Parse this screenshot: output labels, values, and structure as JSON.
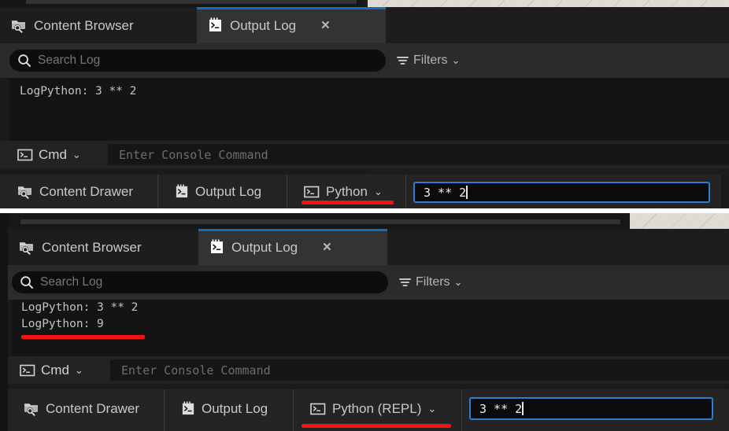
{
  "colors": {
    "accent_blue": "#0d6fc4",
    "input_border_blue": "#2a7fd4",
    "annotation_red": "#fa1212",
    "panel_bg": "#1b1b1b",
    "tab_active_bg": "#333335",
    "log_bg": "#141414",
    "text_primary": "#c8c8c8"
  },
  "panels": [
    {
      "id": "panel-top",
      "tabs": [
        {
          "label": "Content Browser",
          "icon": "folder-search-icon",
          "active": false,
          "closable": false
        },
        {
          "label": "Output Log",
          "icon": "console-notepad-icon",
          "active": true,
          "closable": true,
          "close_label": "✕"
        }
      ],
      "search": {
        "placeholder": "Search Log",
        "icon": "search-icon"
      },
      "filters": {
        "label": "Filters",
        "icon": "filter-icon",
        "chevron": "⌄"
      },
      "log_lines": [
        "LogPython: 3 ** 2"
      ],
      "cmd": {
        "label": "Cmd",
        "icon": "console-prompt-icon",
        "chevron": "⌄",
        "placeholder": "Enter Console Command"
      },
      "statusbar": {
        "items": [
          {
            "label": "Content Drawer",
            "icon": "folder-search-icon"
          },
          {
            "label": "Output Log",
            "icon": "console-notepad-icon"
          },
          {
            "label": "Python",
            "icon": "console-prompt-icon",
            "chevron": "⌄",
            "underlined": true
          }
        ],
        "repl_input": {
          "value": "3 ** 2",
          "caret": true
        }
      }
    },
    {
      "id": "panel-bottom",
      "tabs": [
        {
          "label": "Content Browser",
          "icon": "folder-search-icon",
          "active": false,
          "closable": false
        },
        {
          "label": "Output Log",
          "icon": "console-notepad-icon",
          "active": true,
          "closable": true,
          "close_label": "✕"
        }
      ],
      "search": {
        "placeholder": "Search Log",
        "icon": "search-icon"
      },
      "filters": {
        "label": "Filters",
        "icon": "filter-icon",
        "chevron": "⌄"
      },
      "log_lines": [
        "LogPython: 3 ** 2",
        "LogPython: 9"
      ],
      "log_underline_line_index": 1,
      "cmd": {
        "label": "Cmd",
        "icon": "console-prompt-icon",
        "chevron": "⌄",
        "placeholder": "Enter Console Command"
      },
      "statusbar": {
        "items": [
          {
            "label": "Content Drawer",
            "icon": "folder-search-icon"
          },
          {
            "label": "Output Log",
            "icon": "console-notepad-icon"
          },
          {
            "label": "Python (REPL)",
            "icon": "console-prompt-icon",
            "chevron": "⌄",
            "underlined": true
          }
        ],
        "repl_input": {
          "value": "3 ** 2",
          "caret": true
        }
      }
    }
  ]
}
